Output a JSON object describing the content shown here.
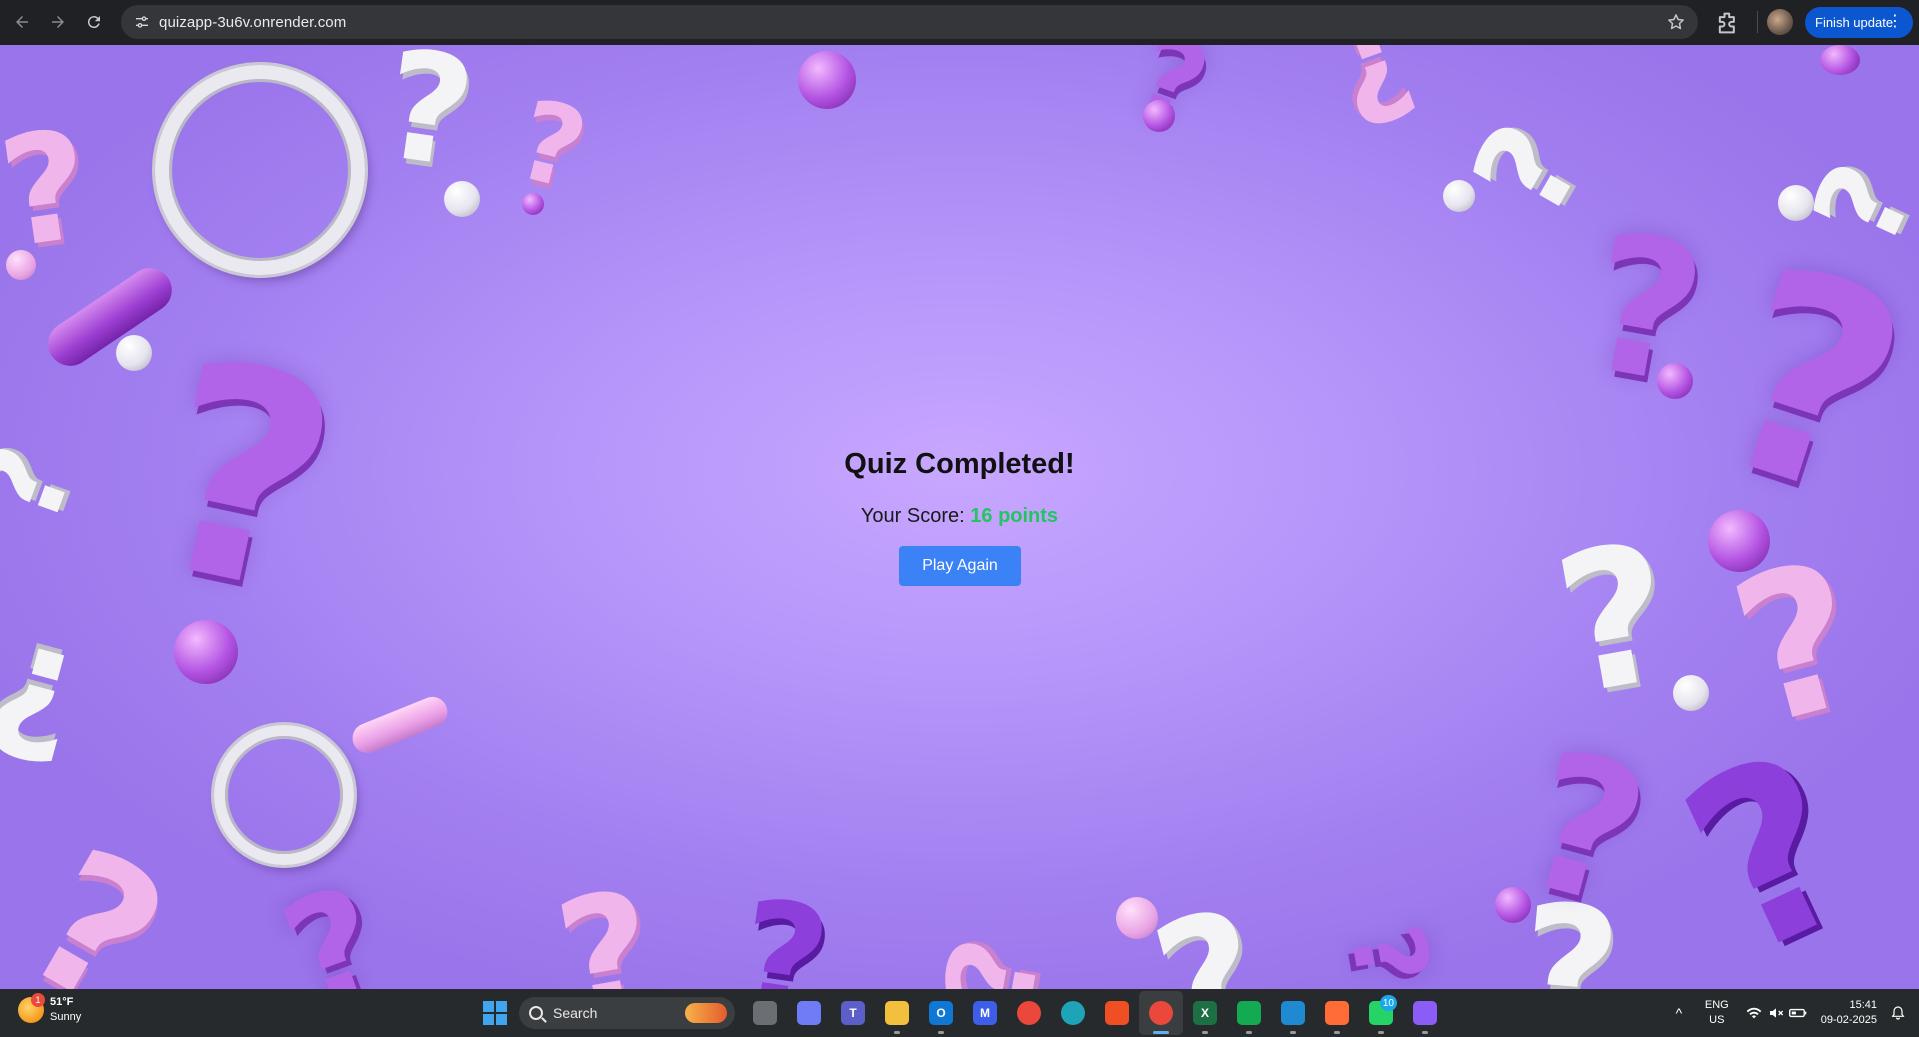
{
  "browser": {
    "url": "quizapp-3u6v.onrender.com",
    "update_label": "Finish update",
    "update_menu_glyph": "⋮",
    "icons": {
      "back": "arrow-left-icon",
      "forward": "arrow-right-icon",
      "reload": "reload-icon",
      "site_info": "tune-icon",
      "bookmark": "star-icon",
      "extensions": "puzzle-icon"
    }
  },
  "quiz": {
    "title": "Quiz Completed!",
    "score_prefix": "Your Score:",
    "score_value": "16 points",
    "play_again_label": "Play Again",
    "colors": {
      "score": "#22c55e",
      "button": "#3b82f6",
      "background": "#b494f9"
    }
  },
  "taskbar": {
    "weather": {
      "temp": "51°F",
      "condition": "Sunny",
      "badge": "1"
    },
    "search_placeholder": "Search",
    "apps": [
      {
        "name": "task-view",
        "label": "",
        "color": "#6b6f73"
      },
      {
        "name": "copilot",
        "label": "",
        "color": "#6f7cf6"
      },
      {
        "name": "teams",
        "label": "T",
        "color": "#5b5fc7"
      },
      {
        "name": "file-explorer",
        "label": "",
        "color": "#f3c03e"
      },
      {
        "name": "outlook",
        "label": "O",
        "color": "#0f78d4"
      },
      {
        "name": "ms-app",
        "label": "M",
        "color": "#3c5ee8"
      },
      {
        "name": "chrome",
        "label": "",
        "color": "#e9483b"
      },
      {
        "name": "edge",
        "label": "",
        "color": "#1fa3b6"
      },
      {
        "name": "brave",
        "label": "",
        "color": "#f04e23"
      },
      {
        "name": "chrome-active",
        "label": "",
        "color": "#e9483b"
      },
      {
        "name": "excel",
        "label": "X",
        "color": "#1d7044"
      },
      {
        "name": "mongodb-compass",
        "label": "",
        "color": "#13aa52"
      },
      {
        "name": "vscode",
        "label": "",
        "color": "#1f8ad2"
      },
      {
        "name": "postman",
        "label": "",
        "color": "#ff6c37"
      },
      {
        "name": "whatsapp",
        "label": "",
        "color": "#25d366",
        "badge": "10"
      },
      {
        "name": "github-desktop",
        "label": "",
        "color": "#8b5cf6"
      }
    ],
    "tray": {
      "chevron": "^",
      "lang_top": "ENG",
      "lang_bottom": "US",
      "time": "15:41",
      "date": "09-02-2025"
    }
  }
}
